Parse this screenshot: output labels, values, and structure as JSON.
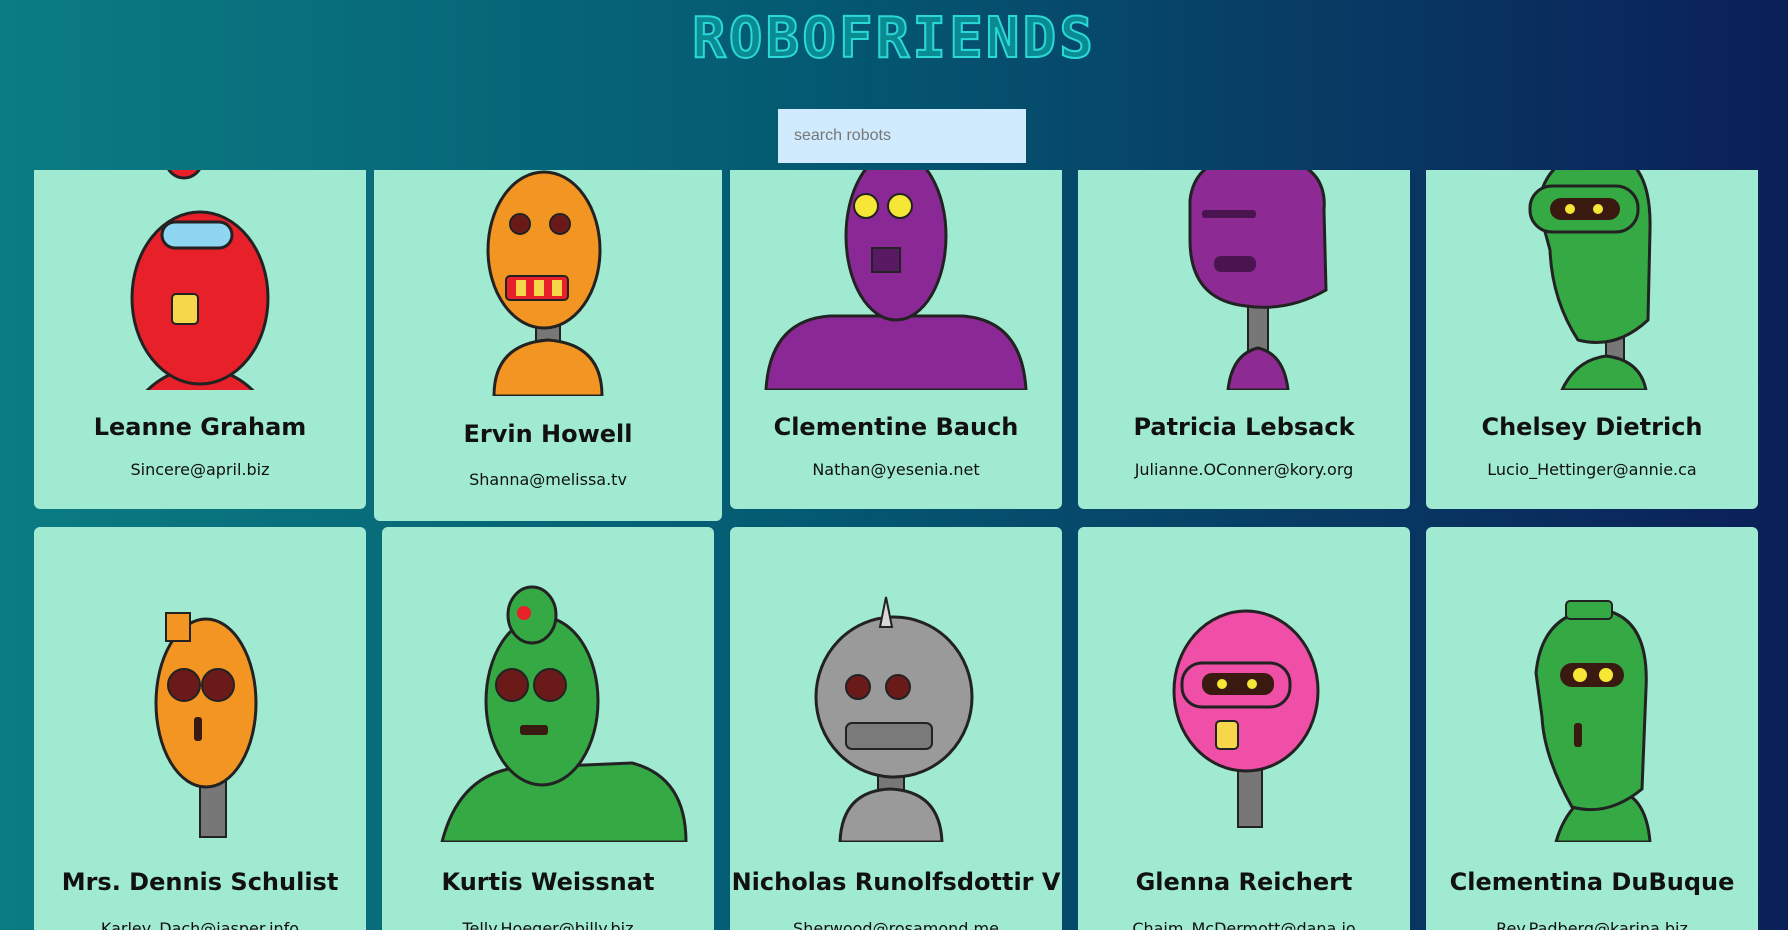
{
  "app": {
    "title": "ROBOFRIENDS"
  },
  "search": {
    "placeholder": "search robots",
    "value": ""
  },
  "robots": [
    {
      "name": "Leanne Graham",
      "email": "Sincere@april.biz",
      "color": "#e8202a"
    },
    {
      "name": "Ervin Howell",
      "email": "Shanna@melissa.tv",
      "color": "#f29522"
    },
    {
      "name": "Clementine Bauch",
      "email": "Nathan@yesenia.net",
      "color": "#8a2896"
    },
    {
      "name": "Patricia Lebsack",
      "email": "Julianne.OConner@kory.org",
      "color": "#8e2a94"
    },
    {
      "name": "Chelsey Dietrich",
      "email": "Lucio_Hettinger@annie.ca",
      "color": "#35a944"
    },
    {
      "name": "Mrs. Dennis Schulist",
      "email": "Karley_Dach@jasper.info",
      "color": "#f29522"
    },
    {
      "name": "Kurtis Weissnat",
      "email": "Telly.Hoeger@billy.biz",
      "color": "#35a944"
    },
    {
      "name": "Nicholas Runolfsdottir V",
      "email": "Sherwood@rosamond.me",
      "color": "#9a9a9a"
    },
    {
      "name": "Glenna Reichert",
      "email": "Chaim_McDermott@dana.io",
      "color": "#ef4fa6"
    },
    {
      "name": "Clementina DuBuque",
      "email": "Rey.Padberg@karina.biz",
      "color": "#35a944"
    }
  ]
}
